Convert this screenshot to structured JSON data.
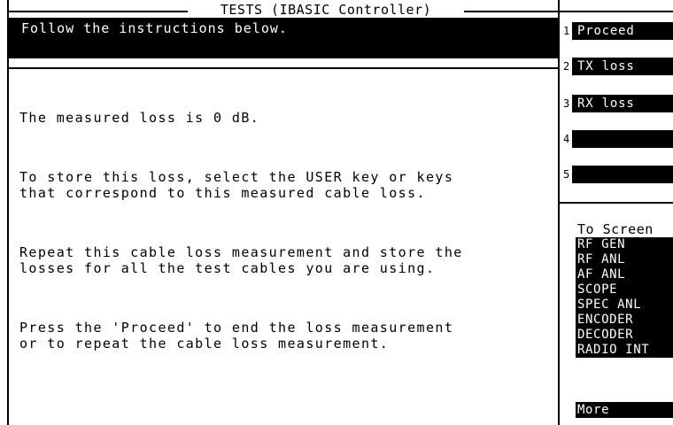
{
  "header": {
    "title": "TESTS (IBASIC Controller)"
  },
  "instruction": {
    "text": "Follow the instructions below."
  },
  "message": {
    "paragraphs": [
      "The measured loss is 0 dB.",
      "To store this loss, select the USER key or keys\nthat correspond to this measured cable loss.",
      "Repeat this cable loss measurement and store the\nlosses for all the test cables you are using.",
      "Press the 'Proceed' to end the loss measurement\nor to repeat the cable loss measurement."
    ]
  },
  "softkeys": [
    {
      "num": "1",
      "label": "Proceed"
    },
    {
      "num": "2",
      "label": "TX loss"
    },
    {
      "num": "3",
      "label": "RX loss"
    },
    {
      "num": "4",
      "label": ""
    },
    {
      "num": "5",
      "label": ""
    }
  ],
  "to_screen": {
    "label": "To Screen",
    "items": [
      "RF GEN",
      "RF ANL",
      "AF ANL",
      "SCOPE",
      "SPEC ANL",
      "ENCODER",
      "DECODER",
      "RADIO INT"
    ],
    "more": "More"
  },
  "colors": {
    "background": "#ffffff",
    "foreground": "#000000",
    "inverse_text": "#ffffff"
  }
}
